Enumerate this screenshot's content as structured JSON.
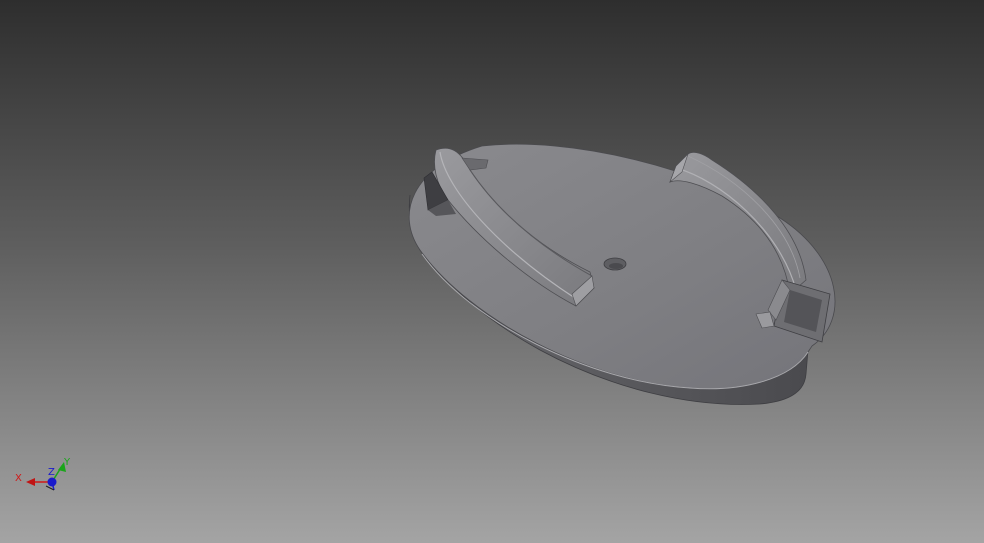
{
  "viewport": {
    "background_top": "#2f2f2f",
    "background_bottom": "#a3a3a3",
    "part_color": "#7b7b80"
  },
  "triad": {
    "x_label": "X",
    "y_label": "Y",
    "z_label": "Z",
    "x_color": "#d01818",
    "y_color": "#1aa51a",
    "z_color": "#1a1acc"
  }
}
